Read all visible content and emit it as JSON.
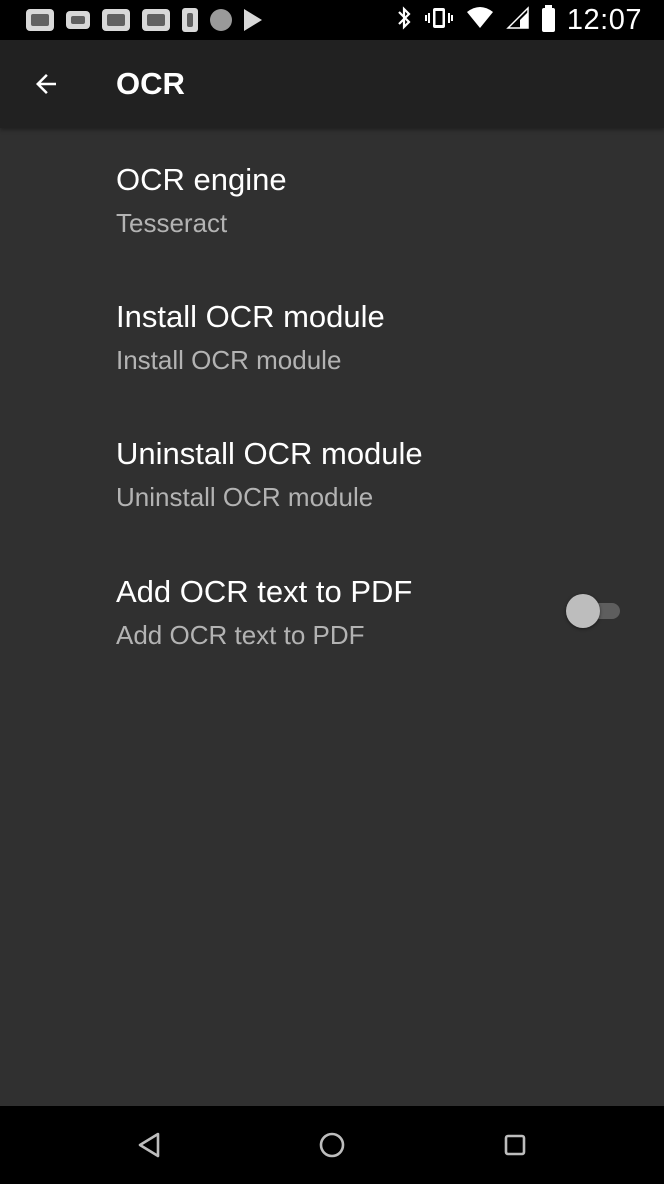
{
  "status_bar": {
    "time": "12:07",
    "notification_icons": [
      "photo-icon",
      "message-icon",
      "image-icon",
      "news-icon",
      "phone-icon",
      "circle-app-icon",
      "play-store-icon"
    ],
    "system_icons": [
      "bluetooth-icon",
      "vibrate-icon",
      "wifi-icon",
      "signal-icon",
      "battery-icon"
    ]
  },
  "toolbar": {
    "title": "OCR",
    "back_icon": "arrow-back-icon"
  },
  "preferences": [
    {
      "title": "OCR engine",
      "summary": "Tesseract"
    },
    {
      "title": "Install OCR module",
      "summary": "Install OCR module"
    },
    {
      "title": "Uninstall OCR module",
      "summary": "Uninstall OCR module"
    },
    {
      "title": "Add OCR text to PDF",
      "summary": "Add OCR text to PDF",
      "switch_on": false
    }
  ],
  "nav_bar": {
    "icons": [
      "back-triangle-icon",
      "home-circle-icon",
      "recents-square-icon"
    ]
  },
  "colors": {
    "background": "#303030",
    "toolbar": "#212121",
    "system_bars": "#000000",
    "secondary_text": "#b3b3b3"
  }
}
